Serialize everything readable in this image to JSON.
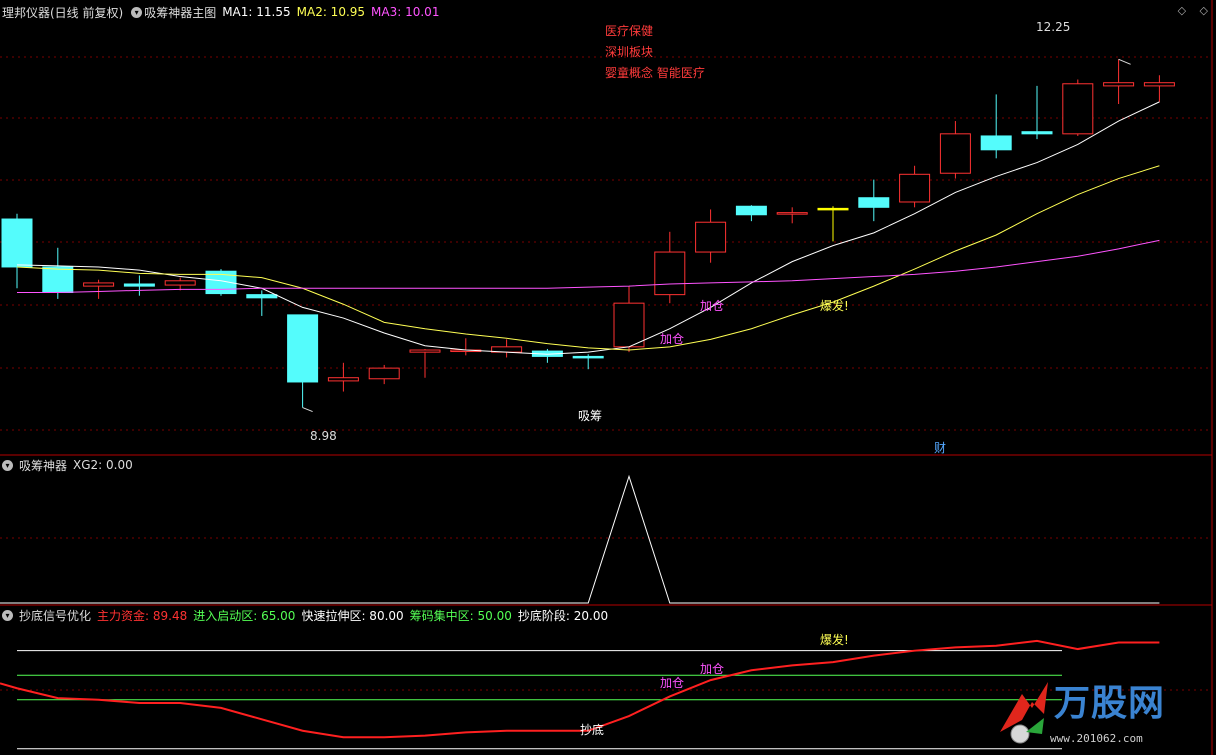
{
  "panel1": {
    "title": "理邦仪器(日线 前复权)",
    "indicator": "吸筹神器主图",
    "ma1": "MA1: 11.55",
    "ma2": "MA2: 10.95",
    "ma3": "MA3: 10.01",
    "news": [
      "医疗保健",
      "深圳板块",
      "婴童概念 智能医疗"
    ],
    "high_label": "12.25",
    "low_label": "8.98",
    "signal_xichou": "吸筹",
    "signal_jiacang1": "加仓",
    "signal_jiacang2": "加仓",
    "signal_baofa": "爆发!",
    "cai_label": "财"
  },
  "panel2": {
    "title": "吸筹神器",
    "xg2": "XG2: 0.00"
  },
  "panel3": {
    "title": "抄底信号优化",
    "main_fund": "主力资金: 89.48",
    "entry_zone": "进入启动区: 65.00",
    "fast_zone": "快速拉伸区: 80.00",
    "chip_zone": "筹码集中区: 50.00",
    "bottom_stage": "抄底阶段: 20.00",
    "signal_chaodi": "抄底",
    "signal_jiacang1": "加仓",
    "signal_jiacang2": "加仓",
    "signal_baofa": "爆发!"
  },
  "logo": {
    "text": "万股网",
    "url": "www.201062.com"
  },
  "colors": {
    "up": "#ff3232",
    "down": "#54fcfc",
    "ma1": "#ffffff",
    "ma2": "#ffff54",
    "ma3": "#ff54ff",
    "divider": "#b40000"
  },
  "chart_data": [
    {
      "type": "candlestick",
      "title": "理邦仪器(日线 前复权)",
      "ylim": [
        8.6,
        12.6
      ],
      "candles": [
        {
          "o": 10.75,
          "h": 10.8,
          "l": 10.1,
          "c": 10.3
        },
        {
          "o": 10.3,
          "h": 10.48,
          "l": 10.0,
          "c": 10.06
        },
        {
          "o": 10.12,
          "h": 10.18,
          "l": 10.0,
          "c": 10.15
        },
        {
          "o": 10.14,
          "h": 10.22,
          "l": 10.03,
          "c": 10.12
        },
        {
          "o": 10.13,
          "h": 10.2,
          "l": 10.08,
          "c": 10.17
        },
        {
          "o": 10.26,
          "h": 10.28,
          "l": 10.03,
          "c": 10.05
        },
        {
          "o": 10.04,
          "h": 10.08,
          "l": 9.84,
          "c": 10.01
        },
        {
          "o": 9.85,
          "h": 9.85,
          "l": 8.98,
          "c": 9.22
        },
        {
          "o": 9.23,
          "h": 9.4,
          "l": 9.13,
          "c": 9.26
        },
        {
          "o": 9.25,
          "h": 9.38,
          "l": 9.2,
          "c": 9.35
        },
        {
          "o": 9.5,
          "h": 9.53,
          "l": 9.26,
          "c": 9.52
        },
        {
          "o": 9.51,
          "h": 9.63,
          "l": 9.47,
          "c": 9.52
        },
        {
          "o": 9.5,
          "h": 9.62,
          "l": 9.45,
          "c": 9.55
        },
        {
          "o": 9.51,
          "h": 9.53,
          "l": 9.4,
          "c": 9.46
        },
        {
          "o": 9.46,
          "h": 9.48,
          "l": 9.34,
          "c": 9.45
        },
        {
          "o": 9.55,
          "h": 10.12,
          "l": 9.5,
          "c": 9.96
        },
        {
          "o": 10.04,
          "h": 10.63,
          "l": 9.96,
          "c": 10.44
        },
        {
          "o": 10.44,
          "h": 10.84,
          "l": 10.34,
          "c": 10.72
        },
        {
          "o": 10.87,
          "h": 10.88,
          "l": 10.73,
          "c": 10.79
        },
        {
          "o": 10.8,
          "h": 10.86,
          "l": 10.71,
          "c": 10.81
        },
        {
          "o": 10.85,
          "h": 10.87,
          "l": 10.54,
          "c": 10.85
        },
        {
          "o": 10.95,
          "h": 11.12,
          "l": 10.73,
          "c": 10.86
        },
        {
          "o": 10.91,
          "h": 11.25,
          "l": 10.86,
          "c": 11.17
        },
        {
          "o": 11.18,
          "h": 11.67,
          "l": 11.13,
          "c": 11.55
        },
        {
          "o": 11.53,
          "h": 11.92,
          "l": 11.32,
          "c": 11.4
        },
        {
          "o": 11.57,
          "h": 12.0,
          "l": 11.5,
          "c": 11.55
        },
        {
          "o": 11.55,
          "h": 12.06,
          "l": 11.53,
          "c": 12.02
        },
        {
          "o": 12.0,
          "h": 12.25,
          "l": 11.83,
          "c": 12.03
        },
        {
          "o": 12.0,
          "h": 12.1,
          "l": 11.85,
          "c": 12.03
        }
      ],
      "series": [
        {
          "name": "MA1",
          "values": [
            10.32,
            10.31,
            10.3,
            10.27,
            10.21,
            10.17,
            10.1,
            9.92,
            9.82,
            9.68,
            9.56,
            9.52,
            9.5,
            9.48,
            9.5,
            9.55,
            9.72,
            9.92,
            10.15,
            10.35,
            10.5,
            10.62,
            10.8,
            11.0,
            11.15,
            11.28,
            11.45,
            11.67,
            11.85
          ]
        },
        {
          "name": "MA2",
          "values": [
            10.3,
            10.28,
            10.27,
            10.24,
            10.23,
            10.23,
            10.2,
            10.1,
            9.95,
            9.78,
            9.72,
            9.67,
            9.63,
            9.58,
            9.54,
            9.52,
            9.55,
            9.62,
            9.72,
            9.85,
            9.97,
            10.12,
            10.28,
            10.45,
            10.6,
            10.8,
            10.98,
            11.13,
            11.25
          ]
        },
        {
          "name": "MA3",
          "values": [
            10.06,
            10.06,
            10.07,
            10.08,
            10.09,
            10.09,
            10.1,
            10.1,
            10.1,
            10.1,
            10.1,
            10.1,
            10.1,
            10.1,
            10.11,
            10.12,
            10.14,
            10.15,
            10.16,
            10.17,
            10.19,
            10.21,
            10.23,
            10.26,
            10.3,
            10.35,
            10.4,
            10.47,
            10.55
          ]
        }
      ]
    },
    {
      "type": "line",
      "title": "吸筹神器",
      "ylim": [
        0,
        1.05
      ],
      "series": [
        {
          "name": "XG2",
          "values": [
            0,
            0,
            0,
            0,
            0,
            0,
            0,
            0,
            0,
            0,
            0,
            0,
            0,
            0,
            0,
            1,
            0,
            0,
            0,
            0,
            0,
            0,
            0,
            0,
            0,
            0,
            0,
            0,
            0
          ]
        }
      ]
    },
    {
      "type": "line",
      "title": "抄底信号优化",
      "ylim": [
        18,
        100
      ],
      "series": [
        {
          "name": "主力资金",
          "values": [
            57,
            51,
            50,
            48,
            48,
            45,
            38,
            31,
            27,
            27,
            28,
            30,
            31,
            31,
            31,
            40,
            52,
            62,
            68,
            71,
            73,
            77,
            80,
            82,
            83,
            86,
            81,
            85,
            85
          ]
        }
      ],
      "levels": [
        {
          "name": "快速拉伸区",
          "value": 80
        },
        {
          "name": "进入启动区",
          "value": 65
        },
        {
          "name": "筹码集中区",
          "value": 50
        },
        {
          "name": "抄底阶段",
          "value": 20
        }
      ]
    }
  ]
}
